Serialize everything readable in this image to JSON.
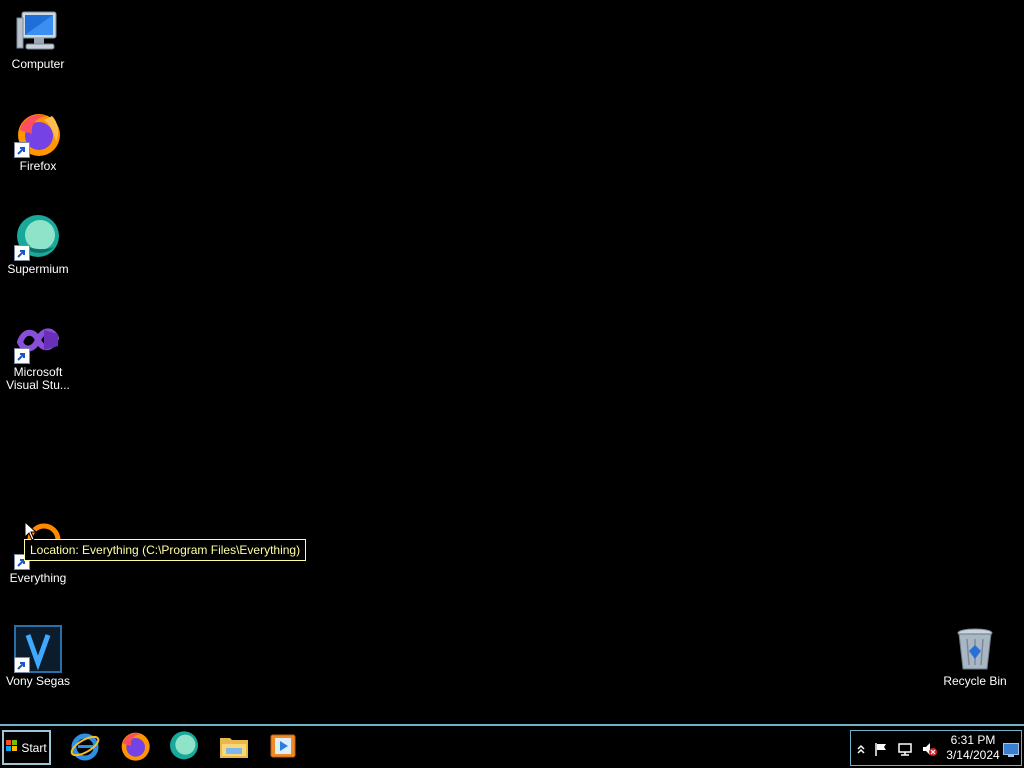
{
  "desktop": {
    "icons": [
      {
        "label": "Computer",
        "icon": "computer-icon",
        "shortcut": false
      },
      {
        "label": "Firefox",
        "icon": "firefox-icon",
        "shortcut": true
      },
      {
        "label": "Supermium",
        "icon": "supermium-icon",
        "shortcut": true
      },
      {
        "label": "Microsoft Visual Stu...",
        "icon": "visual-studio-icon",
        "shortcut": true
      },
      {
        "label": "Everything",
        "icon": "everything-icon",
        "shortcut": true
      },
      {
        "label": "Vony Segas",
        "icon": "vegas-icon",
        "shortcut": true
      },
      {
        "label": "Recycle Bin",
        "icon": "recycle-bin-icon",
        "shortcut": false
      }
    ],
    "tooltip": "Location: Everything (C:\\Program Files\\Everything)"
  },
  "taskbar": {
    "start_label": "Start",
    "pinned": [
      "internet-explorer-icon",
      "firefox-icon",
      "supermium-icon",
      "file-explorer-icon",
      "media-player-icon"
    ],
    "tray": {
      "icons": [
        "show-hidden-icons-chevron-icon",
        "action-center-flag-icon",
        "network-icon",
        "volume-muted-icon"
      ],
      "time": "6:31 PM",
      "date": "3/14/2024"
    }
  },
  "colors": {
    "background": "#000000",
    "taskbar_border": "#6fb3c9",
    "tooltip_text": "#ffffa0"
  }
}
